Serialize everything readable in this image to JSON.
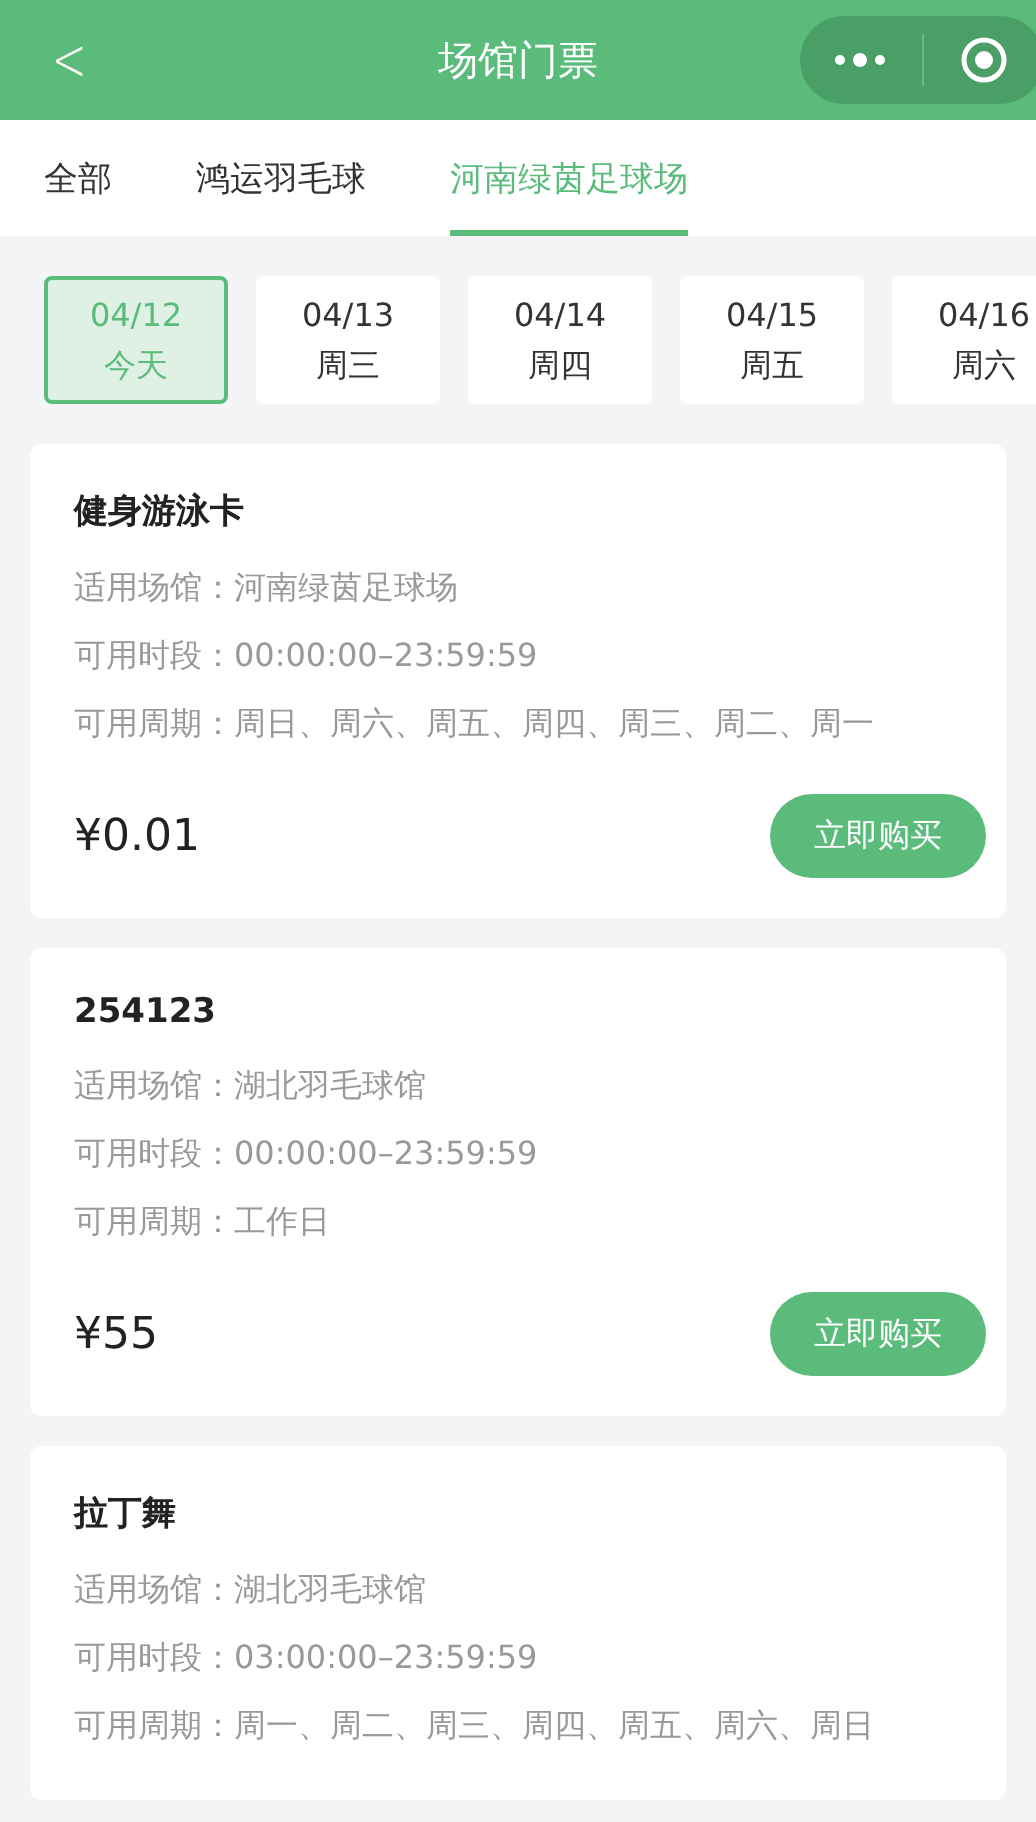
{
  "nav_bar": {
    "back": "<",
    "title": "场馆门票"
  },
  "tabs": [
    {
      "label": "全部",
      "selected": false
    },
    {
      "label": "鸿运羽毛球",
      "selected": false
    },
    {
      "label": "河南绿茵足球场",
      "selected": true
    }
  ],
  "dates": [
    {
      "date": "04/12",
      "day": "今天",
      "selected": true
    },
    {
      "date": "04/13",
      "day": "周三",
      "selected": false
    },
    {
      "date": "04/14",
      "day": "周四",
      "selected": false
    },
    {
      "date": "04/15",
      "day": "周五",
      "selected": false
    },
    {
      "date": "04/16",
      "day": "周六",
      "selected": false
    }
  ],
  "tickets": [
    {
      "name": "健身游泳卡",
      "details": [
        {
          "label": "适用场馆：",
          "value": "河南绿茵足球场"
        },
        {
          "label": "可用时段：",
          "value": "00:00:00–23:59:59"
        },
        {
          "label": "可用周期：",
          "value": "周日、周六、周五、周四、周三、周二、周一"
        }
      ],
      "price": "¥0.01",
      "button": "立即购买"
    },
    {
      "name": "254123",
      "details": [
        {
          "label": "适用场馆：",
          "value": "湖北羽毛球馆"
        },
        {
          "label": "可用时段：",
          "value": "00:00:00–23:59:59"
        },
        {
          "label": "可用周期：",
          "value": "工作日"
        }
      ],
      "price": "¥55",
      "button": "立即购买"
    },
    {
      "name": "拉丁舞",
      "details": [
        {
          "label": "适用场馆：",
          "value": "湖北羽毛球馆"
        },
        {
          "label": "可用时段：",
          "value": "03:00:00–23:59:59"
        },
        {
          "label": "可用周期：",
          "value": "周一、周二、周三、周四、周五、周六、周日"
        }
      ]
    }
  ]
}
